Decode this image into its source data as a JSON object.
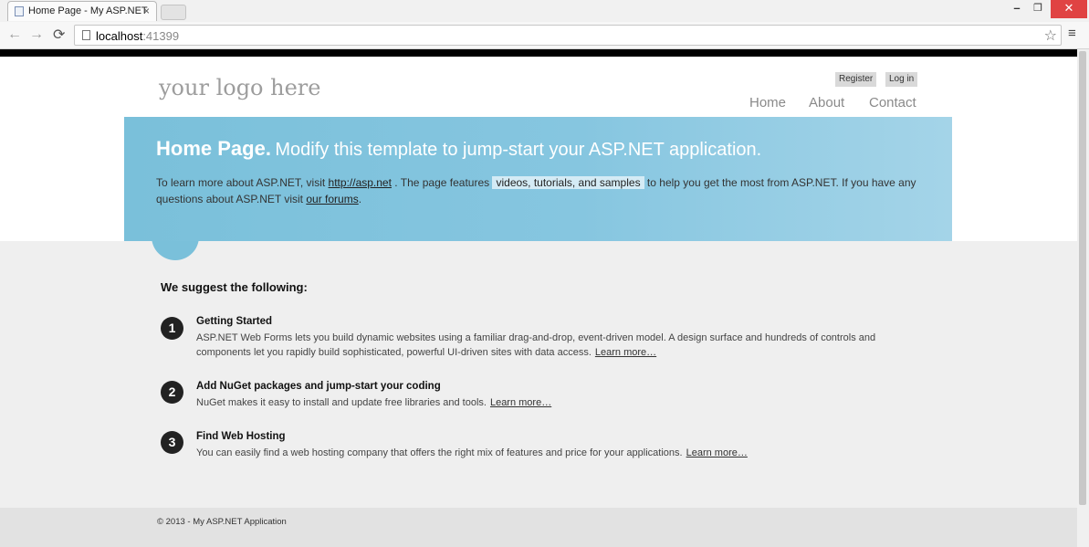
{
  "browser": {
    "tab_title": "Home Page - My ASP.NET",
    "tab_close": "×",
    "url_host": "localhost",
    "url_port": ":41399",
    "win_min": "–",
    "win_max": "❐",
    "win_close": "✕",
    "back_glyph": "←",
    "forward_glyph": "→",
    "reload_glyph": "⟳",
    "star_glyph": "☆",
    "menu_glyph": "≡"
  },
  "header": {
    "logo": "your logo here",
    "register": "Register",
    "login": "Log in",
    "nav": [
      "Home",
      "About",
      "Contact"
    ]
  },
  "featured": {
    "title_strong": "Home Page.",
    "title_rest": "Modify this template to jump-start your ASP.NET application.",
    "text_1": "To learn more about ASP.NET, visit",
    "link_asp": "http://asp.net",
    "text_2": ". The page features",
    "highlight": "videos, tutorials, and samples",
    "text_3": "to help you get the most from ASP.NET. If you have any questions about ASP.NET visit",
    "link_forums": "our forums",
    "text_4": "."
  },
  "suggest": {
    "title": "We suggest the following:",
    "steps": [
      {
        "num": "1",
        "title": "Getting Started",
        "text": "ASP.NET Web Forms lets you build dynamic websites using a familiar drag-and-drop, event-driven model. A design surface and hundreds of controls and components let you rapidly build sophisticated, powerful UI-driven sites with data access.",
        "link": "Learn more…"
      },
      {
        "num": "2",
        "title": "Add NuGet packages and jump-start your coding",
        "text": "NuGet makes it easy to install and update free libraries and tools.",
        "link": "Learn more…"
      },
      {
        "num": "3",
        "title": "Find Web Hosting",
        "text": "You can easily find a web hosting company that offers the right mix of features and price for your applications.",
        "link": "Learn more…"
      }
    ]
  },
  "footer": {
    "text": "© 2013 - My ASP.NET Application"
  },
  "colors": {
    "featured_bg": "#7ac0da",
    "close_button": "#e04343"
  }
}
